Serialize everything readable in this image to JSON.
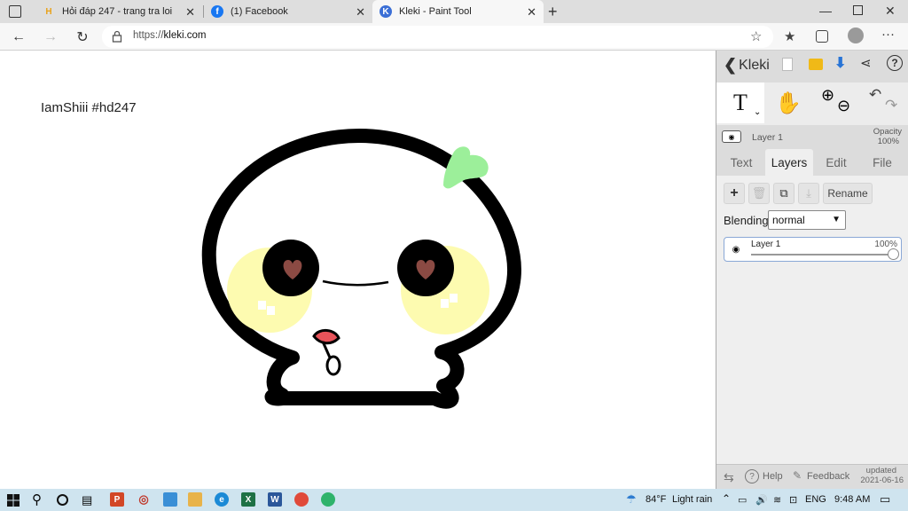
{
  "browser": {
    "tabs": [
      {
        "title": "Hỏi đáp 247 - trang tra loi",
        "active": false
      },
      {
        "title": "(1) Facebook",
        "active": false
      },
      {
        "title": "Kleki - Paint Tool",
        "active": true
      }
    ],
    "url_prefix": "https://",
    "url_domain": "kleki.com"
  },
  "canvas": {
    "text": "IamShiii #hd247"
  },
  "panel": {
    "brand": "Kleki",
    "layer_name": "Layer 1",
    "opacity_label": "Opacity",
    "opacity_value": "100%",
    "tabs": [
      "Text",
      "Layers",
      "Edit",
      "File"
    ],
    "rename_label": "Rename",
    "blending_label": "Blending",
    "blending_value": "normal",
    "layers": [
      {
        "name": "Layer 1",
        "opacity": "100%",
        "opacity_fraction": 1.0
      }
    ],
    "footer": {
      "help": "Help",
      "feedback": "Feedback",
      "updated_label": "updated",
      "updated_date": "2021-06-16"
    }
  },
  "taskbar": {
    "weather_temp": "84°F",
    "weather_desc": "Light rain",
    "language": "ENG",
    "time": "9:48 AM"
  }
}
